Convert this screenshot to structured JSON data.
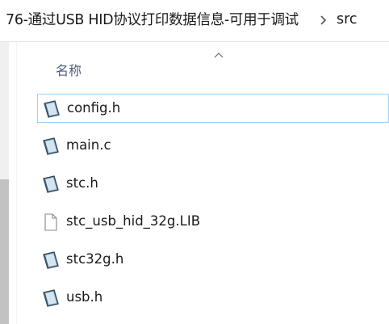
{
  "breadcrumb": {
    "folder": "76-通过USB HID协议打印数据信息-可用于调试",
    "separator_icon": "chevron-right-icon",
    "current": "src"
  },
  "column_header": {
    "name_label": "名称",
    "sort_icon": "chevron-up-icon"
  },
  "files": [
    {
      "name": "config.h",
      "icon": "c-source-file-icon",
      "selected": true
    },
    {
      "name": "main.c",
      "icon": "c-source-file-icon",
      "selected": false
    },
    {
      "name": "stc.h",
      "icon": "c-source-file-icon",
      "selected": false
    },
    {
      "name": "stc_usb_hid_32g.LIB",
      "icon": "blank-file-icon",
      "selected": false
    },
    {
      "name": "stc32g.h",
      "icon": "c-source-file-icon",
      "selected": false
    },
    {
      "name": "usb.h",
      "icon": "c-source-file-icon",
      "selected": false
    }
  ],
  "colors": {
    "selection_border": "#99d1ff",
    "header_text": "#4c607a",
    "scrollbar_thumb": "#c2c2c2"
  }
}
